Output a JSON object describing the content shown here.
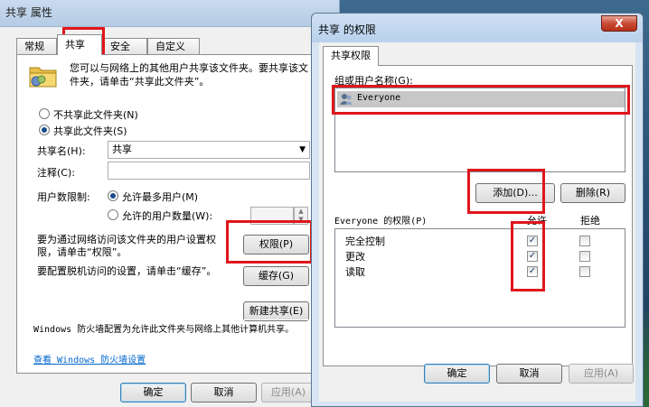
{
  "left_window": {
    "title": "共享 属性",
    "tabs": [
      "常规",
      "共享",
      "安全",
      "自定义"
    ],
    "description": "您可以与网络上的其他用户共享该文件夹。要共享该文件夹，请单击“共享此文件夹”。",
    "radio_no_share": "不共享此文件夹(N)",
    "radio_share": "共享此文件夹(S)",
    "share_name_label": "共享名(H):",
    "share_name_value": "共享",
    "comment_label": "注释(C):",
    "user_limit_label": "用户数限制:",
    "radio_max_users": "允许最多用户(M)",
    "radio_allowed_users": "允许的用户数量(W):",
    "permissions_hint": "要为通过网络访问该文件夹的用户设置权限，请单击“权限”。",
    "permissions_button": "权限(P)",
    "cache_hint": "要配置脱机访问的设置，请单击“缓存”。",
    "cache_button": "缓存(G)",
    "new_share_button": "新建共享(E)",
    "firewall_text": "Windows 防火墙配置为允许此文件夹与网络上其他计算机共享。",
    "firewall_link": "查看 Windows 防火墙设置",
    "ok": "确定",
    "cancel": "取消",
    "apply": "应用(A)"
  },
  "right_window": {
    "title": "共享 的权限",
    "close": "X",
    "tab": "共享权限",
    "group_label": "组或用户名称(G):",
    "users": [
      "Everyone"
    ],
    "add_button": "添加(D)...",
    "remove_button": "删除(R)",
    "perm_label": "Everyone 的权限(P)",
    "col_allow": "允许",
    "col_deny": "拒绝",
    "permissions": [
      {
        "name": "完全控制",
        "allow": true,
        "deny": false
      },
      {
        "name": "更改",
        "allow": true,
        "deny": false
      },
      {
        "name": "读取",
        "allow": true,
        "deny": false
      }
    ],
    "ok": "确定",
    "cancel": "取消",
    "apply": "应用(A)"
  },
  "colors": {
    "highlight": "#e0161b",
    "link": "#0066cc"
  },
  "icons": [
    "folder-icon",
    "users-group-icon",
    "checkmark-icon",
    "close-icon",
    "dropdown-arrow-icon",
    "spin-up-icon",
    "spin-down-icon"
  ]
}
